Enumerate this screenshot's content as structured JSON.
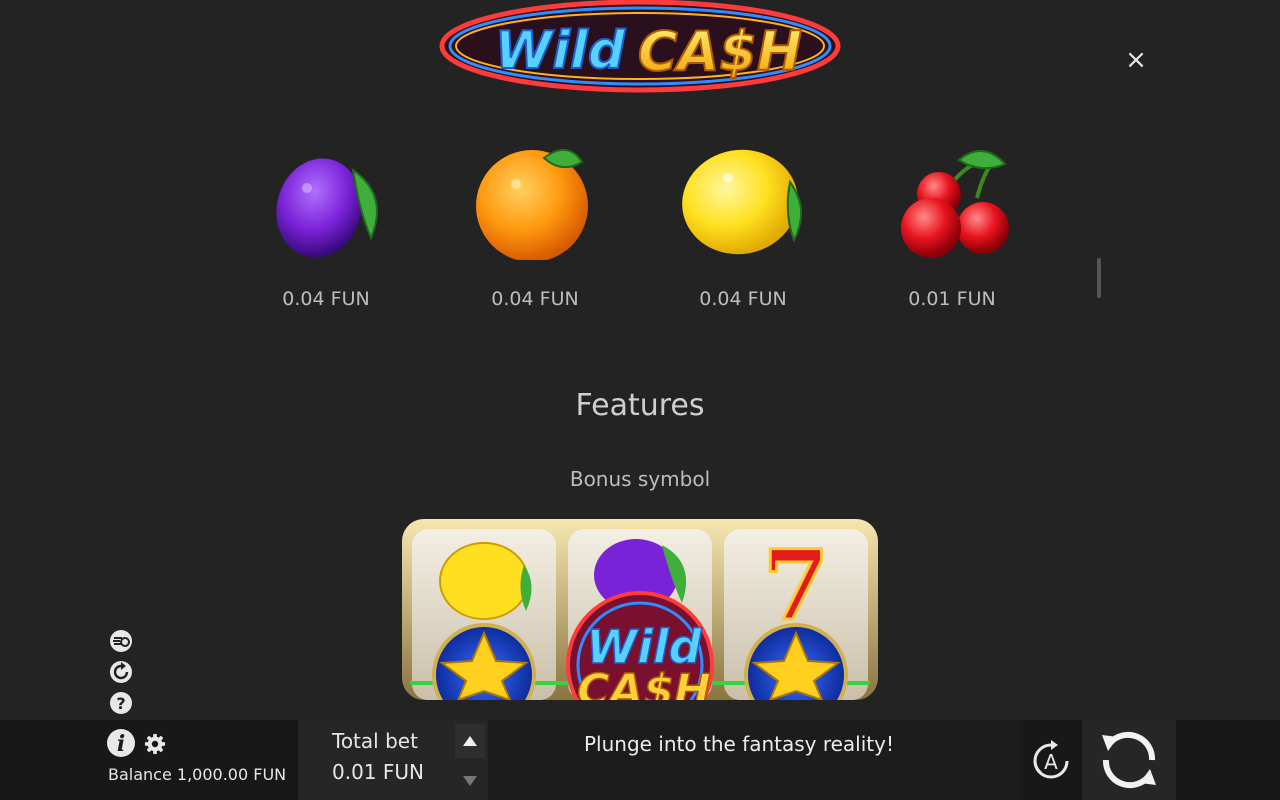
{
  "header": {
    "logo_text_1": "Wild",
    "logo_text_2": "CA$H",
    "close_label": "×"
  },
  "paytable": [
    {
      "symbol": "plum",
      "value": "0.04 FUN"
    },
    {
      "symbol": "orange",
      "value": "0.04 FUN"
    },
    {
      "symbol": "lemon",
      "value": "0.04 FUN"
    },
    {
      "symbol": "cherries",
      "value": "0.01 FUN"
    }
  ],
  "features": {
    "title": "Features",
    "bonus_title": "Bonus symbol",
    "reel_logo_1": "Wild",
    "reel_logo_2": "CA$H",
    "reel_seven": "7"
  },
  "side_icons": [
    "turbo-icon",
    "autoplay-history-icon",
    "help-icon"
  ],
  "footer": {
    "balance": "Balance 1,000.00 FUN",
    "total_bet_label": "Total bet",
    "total_bet_value": "0.01 FUN",
    "message": "Plunge into the fantasy reality!",
    "auto_label": "A"
  },
  "colors": {
    "background": "#232323",
    "bar": "#181818",
    "text": "#e6e6e6",
    "logo_blue": "#3fb6ff",
    "logo_gold": "#ffd23a"
  }
}
